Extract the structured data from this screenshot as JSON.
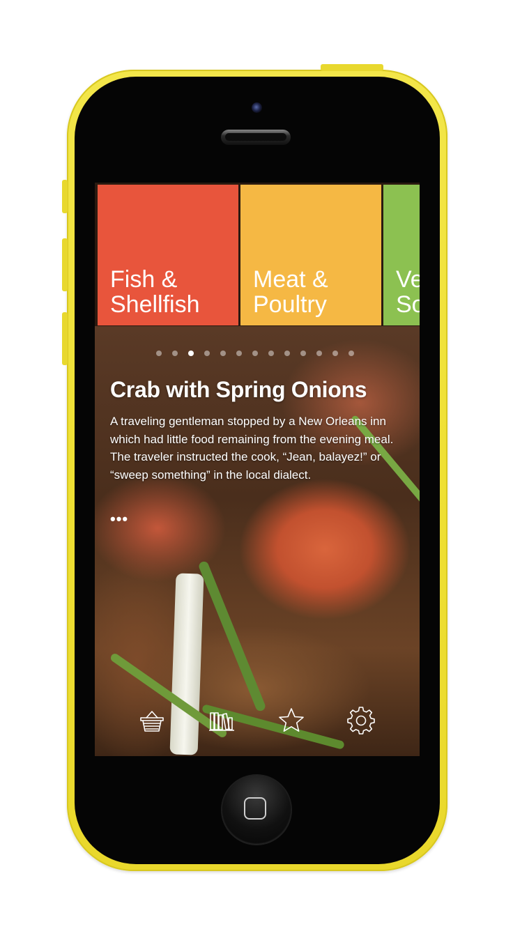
{
  "categories": [
    {
      "label": "Fish &\nShellfish",
      "color": "#e8553c"
    },
    {
      "label": "Meat &\nPoultry",
      "color": "#f5b844"
    },
    {
      "label": "Ve\nSo",
      "color": "#8cc151"
    }
  ],
  "pager": {
    "count": 13,
    "active_index": 2
  },
  "recipe": {
    "title": "Crab with Spring Onions",
    "description": "A traveling gentleman stopped by a New Orleans inn which had little food remaining from the evening meal. The traveler instructed the cook, “Jean, balayez!” or “sweep something” in the local dialect.",
    "more_label": "•••"
  },
  "tabbar": {
    "items": [
      {
        "name": "basket-icon"
      },
      {
        "name": "library-icon"
      },
      {
        "name": "star-icon"
      },
      {
        "name": "gear-icon"
      }
    ]
  },
  "colors": {
    "phone_body": "#f0e13a",
    "fish": "#e8553c",
    "meat": "#f5b844",
    "veg": "#8cc151"
  }
}
